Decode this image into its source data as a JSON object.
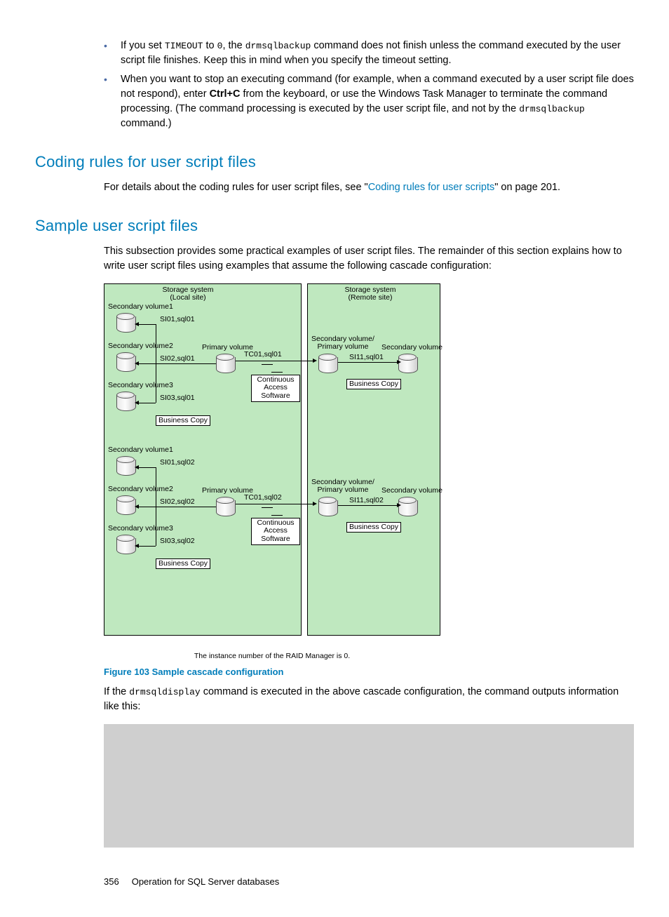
{
  "bullets": [
    {
      "pre": "If you set ",
      "code1": "TIMEOUT",
      "mid1": " to ",
      "code2": "0",
      "mid2": ", the ",
      "code3": "drmsqlbackup",
      "post": " command does not finish unless the command executed by the user script file finishes. Keep this in mind when you specify the timeout setting."
    },
    {
      "pre": "When you want to stop an executing command (for example, when a command executed by a user script file does not respond), enter ",
      "bold": "Ctrl+C",
      "mid": " from the keyboard, or use the Windows Task Manager to terminate the command processing. (The command processing is executed by the user script file, and not by the ",
      "code": "drmsqlbackup",
      "post": " command.)"
    }
  ],
  "headings": {
    "coding_rules": "Coding rules for user script files",
    "sample_files": "Sample user script files"
  },
  "coding_rules_para": {
    "pre": "For details about the coding rules for user script files, see \"",
    "link": "Coding rules for user scripts",
    "post": "\" on page 201."
  },
  "sample_intro": "This subsection provides some practical examples of user script files. The remainder of this section explains how to write user script files using examples that assume the following cascade configuration:",
  "figure": {
    "caption": "Figure 103 Sample cascade configuration",
    "subnote": "The instance number of  the RAID Manager is 0.",
    "local_title": "Storage system\n(Local site)",
    "remote_title": "Storage system\n(Remote site)",
    "sv1": "Secondary volume1",
    "sv2": "Secondary volume2",
    "sv3": "Secondary volume3",
    "pv": "Primary volume",
    "svpv": "Secondary volume/\nPrimary volume",
    "sv": "Secondary volume",
    "si01_1": "SI01,sql01",
    "si02_1": "SI02,sql01",
    "si03_1": "SI03,sql01",
    "tc01_1": "TC01,sql01",
    "si11_1": "SI11,sql01",
    "si01_2": "SI01,sql02",
    "si02_2": "SI02,sql02",
    "si03_2": "SI03,sql02",
    "tc01_2": "TC01,sql02",
    "si11_2": "SI11,sql02",
    "bc": "Business Copy",
    "cas": "Continuous\nAccess\nSoftware"
  },
  "exec_para": {
    "pre": "If the ",
    "code": "drmsqldisplay",
    "post": " command is executed in the above cascade configuration, the command outputs information like this:"
  },
  "codeblock": "",
  "footer": {
    "page": "356",
    "title": "Operation for SQL Server databases"
  }
}
